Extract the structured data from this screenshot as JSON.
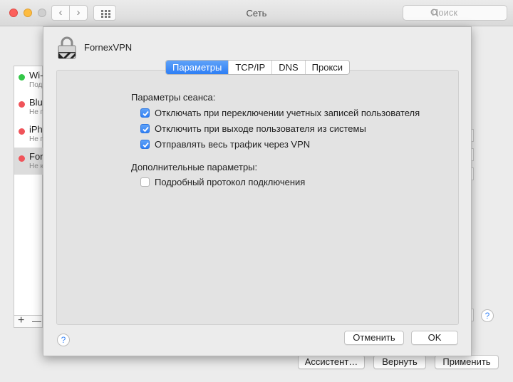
{
  "window": {
    "title": "Сеть",
    "search_placeholder": "Поиск",
    "nav_back": "‹",
    "nav_fwd": "›"
  },
  "services": [
    {
      "name": "Wi-Fi",
      "status": "Под",
      "dot_color": "#34c748"
    },
    {
      "name": "Bluetooth",
      "status": "Не п",
      "dot_color": "#f0545a"
    },
    {
      "name": "iPhone",
      "status": "Не п",
      "dot_color": "#f0545a"
    },
    {
      "name": "FornexVPN",
      "status": "Не к",
      "dot_color": "#f0545a"
    }
  ],
  "list_tools": {
    "add": "+",
    "remove": "—"
  },
  "bottom_buttons": {
    "assistant": "Ассистент…",
    "revert": "Вернуть",
    "apply": "Применить"
  },
  "help_label": "?",
  "sheet": {
    "vpn_name": "FornexVPN",
    "tabs": [
      {
        "label": "Параметры",
        "active": true
      },
      {
        "label": "TCP/IP",
        "active": false
      },
      {
        "label": "DNS",
        "active": false
      },
      {
        "label": "Прокси",
        "active": false
      }
    ],
    "session_title": "Параметры сеанса:",
    "session_options": [
      {
        "label": "Отключать при переключении учетных записей пользователя",
        "checked": true
      },
      {
        "label": "Отключить при выходе пользователя из системы",
        "checked": true
      },
      {
        "label": "Отправлять весь трафик через VPN",
        "checked": true
      }
    ],
    "advanced_title": "Дополнительные параметры:",
    "advanced_options": [
      {
        "label": "Подробный протокол подключения",
        "checked": false
      }
    ],
    "cancel_label": "Отменить",
    "ok_label": "OK"
  },
  "colors": {
    "accent": "#3b87f7"
  }
}
